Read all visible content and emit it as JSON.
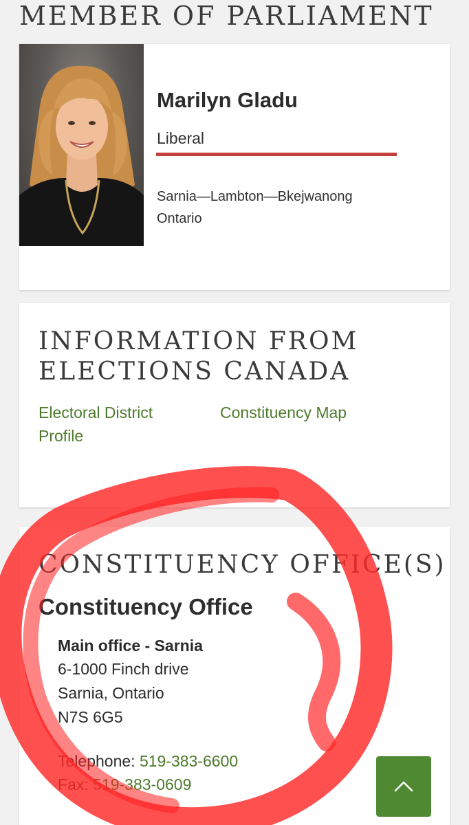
{
  "page": {
    "title": "MEMBER OF PARLIAMENT"
  },
  "mp": {
    "name": "Marilyn Gladu",
    "party": "Liberal",
    "party_color": "#c53f3a",
    "riding": "Sarnia—Lambton—Bkejwanong",
    "province": "Ontario"
  },
  "elections": {
    "heading": "INFORMATION FROM ELECTIONS CANADA",
    "links": {
      "profile": "Electoral District Profile",
      "map": "Constituency Map"
    },
    "link_color": "#4e7a2c"
  },
  "offices": {
    "heading": "CONSTITUENCY OFFICE(S)",
    "subheading": "Constituency Office",
    "main": {
      "name": "Main office - Sarnia",
      "address_line1": "6-1000 Finch drive",
      "address_line2": "Sarnia, Ontario",
      "postal_code": "N7S 6G5",
      "telephone_label": "Telephone:",
      "telephone": "519-383-6600",
      "fax_label": "Fax:",
      "fax": "519-383-0609"
    }
  },
  "scroll_top": {
    "icon": "chevron-up-icon",
    "color": "#4f8a33"
  },
  "annotation": {
    "color": "#ff2a2a"
  }
}
